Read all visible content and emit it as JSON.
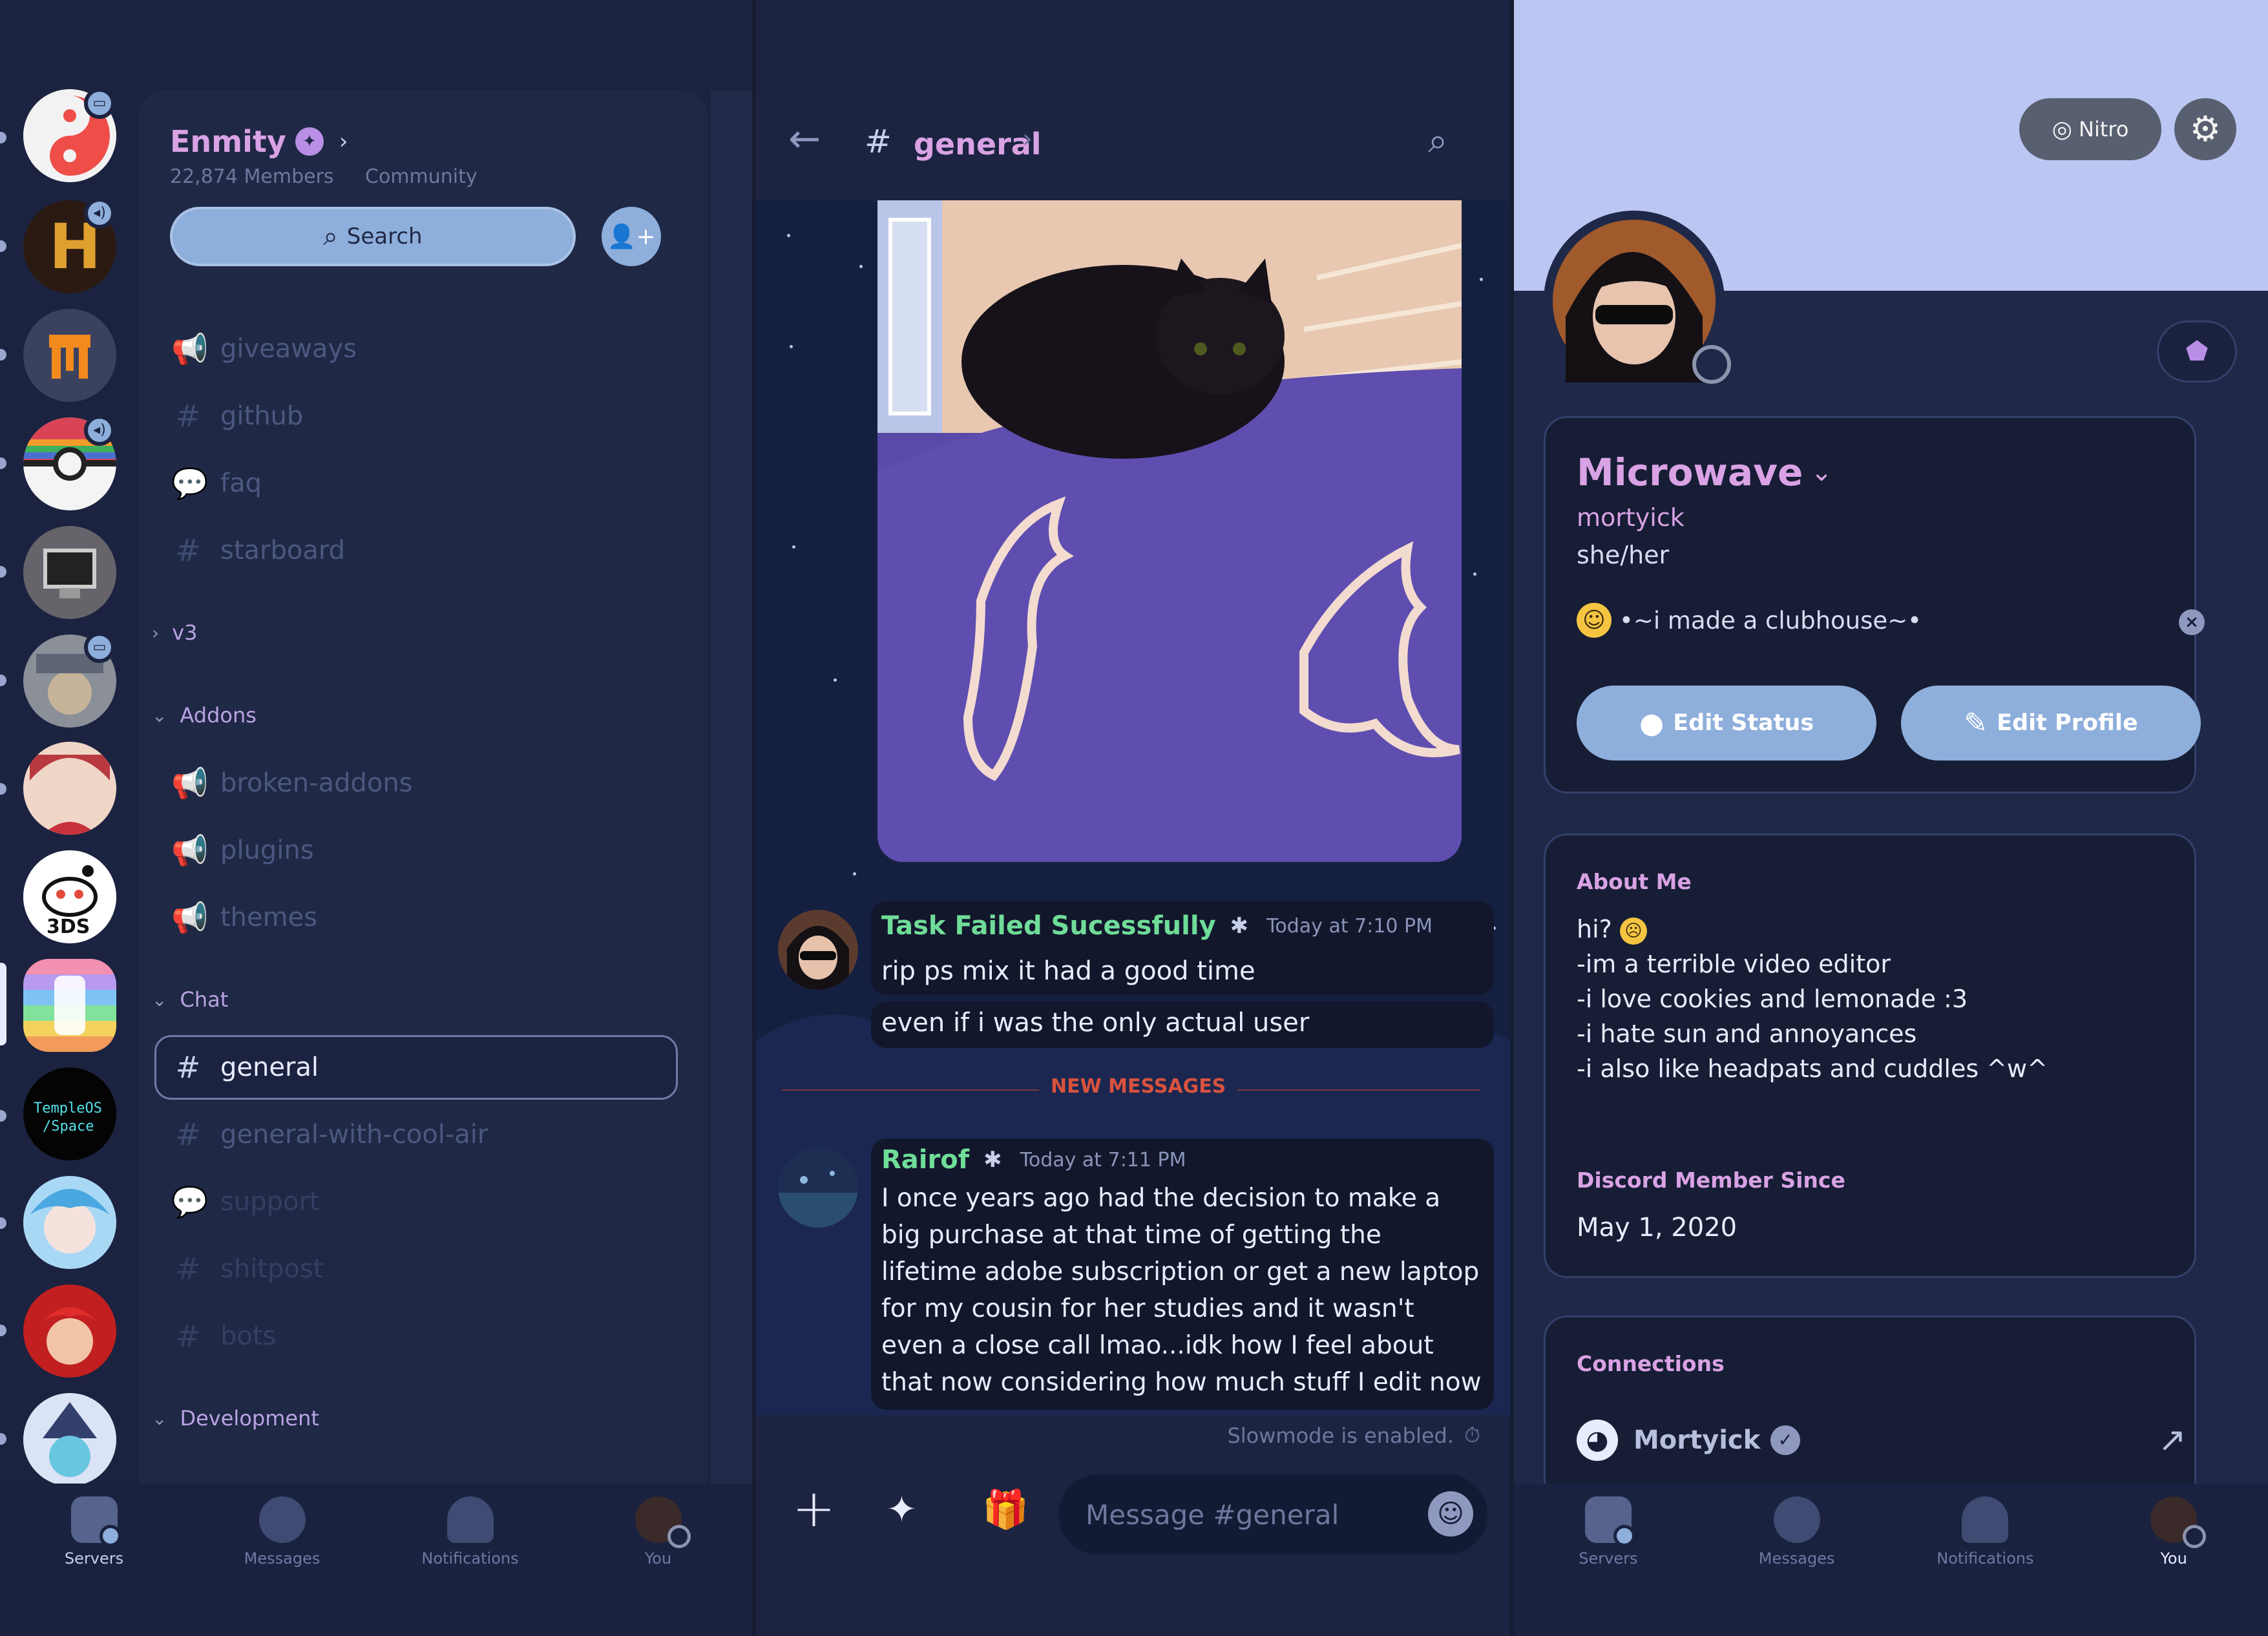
{
  "servers_panel": {
    "server_name": "Enmity",
    "member_count": "22,874 Members",
    "community_label": "Community",
    "search_label": "Search",
    "channels": [
      {
        "name": "giveaways",
        "icon": "megaphone"
      },
      {
        "name": "github",
        "icon": "hash"
      },
      {
        "name": "faq",
        "icon": "forum"
      },
      {
        "name": "starboard",
        "icon": "hash"
      }
    ],
    "categories": {
      "v3": "v3",
      "addons": "Addons",
      "chat": "Chat",
      "development": "Development"
    },
    "addon_channels": [
      {
        "name": "broken-addons"
      },
      {
        "name": "plugins"
      },
      {
        "name": "themes"
      }
    ],
    "chat_channels": [
      {
        "name": "general",
        "icon": "hash",
        "selected": true
      },
      {
        "name": "general-with-cool-air",
        "icon": "hash"
      },
      {
        "name": "support",
        "icon": "forum"
      },
      {
        "name": "shitpost",
        "icon": "hash"
      },
      {
        "name": "bots",
        "icon": "hash"
      }
    ],
    "templeos_label": "TempleOS Space",
    "reddit_label": "3DS"
  },
  "tabbar": {
    "servers": "Servers",
    "messages": "Messages",
    "notifications": "Notifications",
    "you": "You"
  },
  "chat": {
    "channel": "general",
    "messages": [
      {
        "author": "Task Failed Sucessfully",
        "time": "Today at 7:10 PM",
        "lines": [
          "rip ps mix it had a good time",
          "even if i was the only actual user"
        ]
      },
      {
        "author": "Rairof",
        "time": "Today at 7:11 PM",
        "text": "I once years ago had the decision to make a big purchase at that time of getting the lifetime adobe subscription or get a new laptop for my cousin for her studies and it wasn't even a close call lmao...idk how I feel about that now considering how much stuff I edit now"
      }
    ],
    "new_messages_label": "NEW MESSAGES",
    "slowmode": "Slowmode is enabled.",
    "input_placeholder": "Message #general"
  },
  "profile": {
    "nitro_label": "Nitro",
    "display_name": "Microwave",
    "username": "mortyick",
    "pronouns": "she/her",
    "status": "•~i made a clubhouse~•",
    "edit_status": "Edit Status",
    "edit_profile": "Edit Profile",
    "about_title": "About Me",
    "about_lines": [
      "hi?",
      "-im a terrible video editor",
      "-i love cookies and lemonade :3",
      "-i hate sun and annoyances",
      "-i also like headpats and cuddles ^w^"
    ],
    "member_since_title": "Discord Member Since",
    "member_since": "May 1, 2020",
    "connections_title": "Connections",
    "connection_name": "Mortyick"
  },
  "colors": {
    "accent_pink": "#d9a2e4",
    "accent_green": "#6fdc98",
    "button_blue": "#8eaedb",
    "new_messages_red": "#d8523e",
    "banner": "#bcc6f2"
  }
}
